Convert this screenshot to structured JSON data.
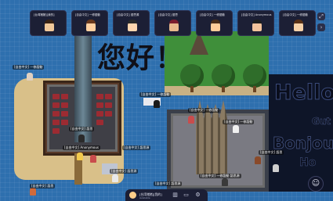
{
  "topbar": {
    "participants": [
      {
        "label": "[台湾猪猪][我的]",
        "skin": "#f1c89a",
        "hair": "#3a2416",
        "accent": "#e0453b"
      },
      {
        "label": "[自由中文] 一修語動",
        "skin": "#ffd0a0",
        "hair": "#6a3a1e",
        "accent": "#3b82e0"
      },
      {
        "label": "[自由中文] 語思源",
        "skin": "#ffd6ae",
        "hair": "#2a2a2a",
        "accent": "#e0b23b"
      },
      {
        "label": "[自由中文] 語思",
        "skin": "#e8b98d",
        "hair": "#7a1d2e",
        "accent": "#8b3be0"
      },
      {
        "label": "[自由中文] 一修語動",
        "skin": "#ffcc99",
        "hair": "#4a2e1a",
        "accent": "#3bd07a"
      },
      {
        "label": "[自由中文] Anonymous",
        "skin": "#f3c39b",
        "hair": "#1f1f1f",
        "accent": "#e03b8a"
      },
      {
        "label": "[自由中文] 一修語動",
        "skin": "#f6d1a8",
        "hair": "#5a3217",
        "accent": "#3bc4e0"
      }
    ],
    "expand_icon": "expand-icon",
    "more_icon": "chevron-right-icon"
  },
  "map": {
    "greeting_zh": "您好！",
    "greeting_hello": "Hello",
    "greeting_gut": "Gut",
    "greeting_bonjour": "Bonjour",
    "greeting_ho": "Ho"
  },
  "labels": {
    "left_top": "[自由中文] 一修語動",
    "left_mid": "[自由中文] 語思",
    "center_tag": "[自由中文] 一修語動",
    "plaza_left": "[自由中文] 語思源",
    "plaza_right": "[自由中文] 一修語動",
    "bottom_left": "[自由中文] 語思",
    "bottom_center": "[自由中文] 一修語動 語思源",
    "bottom_center_2": "[自由中文] 語思源",
    "bottom_right": "[自由中文] 語思",
    "church_label": "[自由中文] 一修語動",
    "anonymous": "[自由中文] Anonymous",
    "self": "[自由中文] 語思源"
  },
  "bottombar": {
    "name": "[台湾猪猪][我的]",
    "status": "Available",
    "icons": [
      "map-icon",
      "screen-share-icon",
      "settings-icon"
    ]
  },
  "corner": {
    "icon": "smile-icon"
  },
  "colors": {
    "water": "#2e6fae",
    "sand": "#d9c089",
    "grass": "#3f8f3a",
    "panel": "#1c1f35"
  }
}
